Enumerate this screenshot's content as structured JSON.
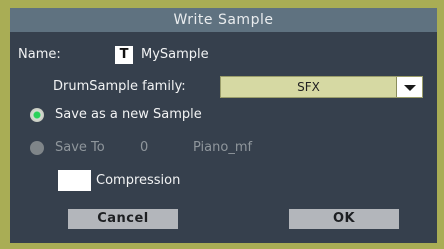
{
  "dialog": {
    "title": "Write Sample",
    "name_label": "Name:",
    "name_icon_glyph": "T",
    "name_value": "MySample",
    "family_label": "DrumSample family:",
    "family_value": "SFX",
    "save_new_label": "Save as a new Sample",
    "save_to_label": "Save To",
    "save_to_number": "0",
    "save_to_target": "Piano_mf",
    "compression_label": "Compression",
    "compression_checked": false,
    "save_mode": "new",
    "cancel_label": "Cancel",
    "ok_label": "OK"
  },
  "colors": {
    "frame": "#a9ad55",
    "background": "#36404d",
    "titlebar": "#5f7280",
    "radio_active": "#2bd15a",
    "select_bg": "#d6d9a3",
    "button_bg": "#b3b6bb"
  },
  "icons": {
    "name_edit": "text-edit-icon",
    "dropdown": "chevron-down-icon"
  }
}
